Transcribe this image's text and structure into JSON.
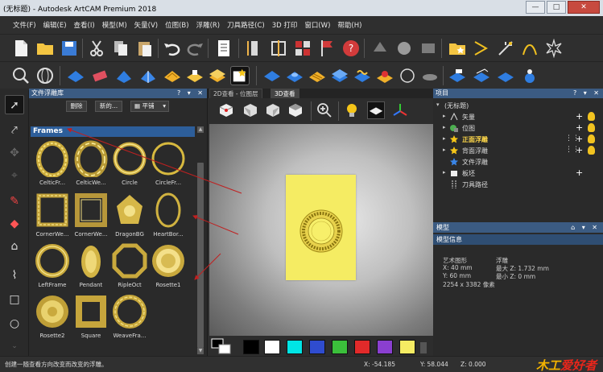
{
  "window": {
    "title": "(无标题) - Autodesk ArtCAM Premium 2018",
    "min": "—",
    "max": "□",
    "close": "✕"
  },
  "menu": [
    "文件(F)",
    "编辑(E)",
    "查看(I)",
    "模型(M)",
    "矢量(V)",
    "位图(B)",
    "浮雕(R)",
    "刀具路径(C)",
    "3D 打印",
    "窗口(W)",
    "帮助(H)"
  ],
  "library": {
    "title": "文件浮雕库",
    "controls": "? ▾ ✕",
    "delete_btn": "删除",
    "new_btn": "新的...",
    "view_mode": "平铺",
    "category": "Frames",
    "items": [
      "CelticFr...",
      "CelticWe...",
      "Circle",
      "CircleFr...",
      "CornerWe...",
      "CornerWe...",
      "DragonBG",
      "HeartBor...",
      "LeftFrame",
      "Pendant",
      "RipleOct",
      "Rosette1",
      "Rosette2",
      "Square",
      "WeaveFra..."
    ]
  },
  "view": {
    "tabs": [
      "2D查看 - 位图层",
      "3D查看"
    ],
    "active_tab": 1
  },
  "palette": {
    "colors": [
      "#000000",
      "#ffffff",
      "#00e5e5",
      "#2f4ccf",
      "#3bbf3b",
      "#e22a2a",
      "#8a3fd0",
      "#f5ec63"
    ]
  },
  "project": {
    "title": "项目",
    "controls": "? ▾ ✕",
    "root": "(无标题)",
    "items": [
      {
        "label": "矢量",
        "bold": false
      },
      {
        "label": "位图",
        "bold": false
      },
      {
        "label": "正面浮雕",
        "bold": true
      },
      {
        "label": "背面浮雕",
        "bold": false
      },
      {
        "label": "文件浮雕",
        "bold": false
      },
      {
        "label": "板坯",
        "bold": false
      },
      {
        "label": "刀具路径",
        "bold": false
      }
    ]
  },
  "model": {
    "title": "模型",
    "info_title": "模型信息",
    "left_head": "艺术图形",
    "x": "X: 40 mm",
    "y": "Y: 60 mm",
    "pixels": "2254 x 3382 像素",
    "right_head": "浮雕",
    "maxz": "最大 Z: 1.732 mm",
    "minz": "最小 Z: 0 mm"
  },
  "status": {
    "text": "创建一随查看方向改变而改变的浮雕。",
    "x": "X: -54.185",
    "y": "Y: 58.044",
    "z": "Z: 0.000",
    "logo_a": "木工",
    "logo_b": "爱好者"
  }
}
